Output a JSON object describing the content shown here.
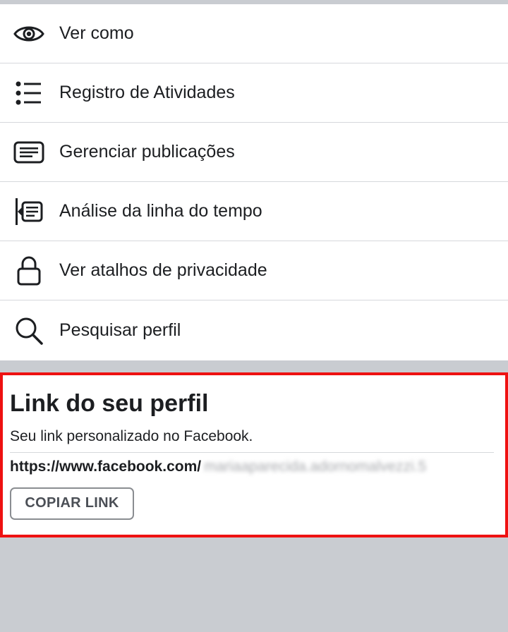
{
  "menu": {
    "items": [
      {
        "label": "Ver como",
        "icon": "eye-icon"
      },
      {
        "label": "Registro de Atividades",
        "icon": "list-icon"
      },
      {
        "label": "Gerenciar publicações",
        "icon": "posts-icon"
      },
      {
        "label": "Análise da linha do tempo",
        "icon": "timeline-review-icon"
      },
      {
        "label": "Ver atalhos de privacidade",
        "icon": "lock-icon"
      },
      {
        "label": "Pesquisar perfil",
        "icon": "search-icon"
      }
    ]
  },
  "profile_link": {
    "title": "Link do seu perfil",
    "subtitle": "Seu link personalizado no Facebook.",
    "url_prefix": "https://www.facebook.com/",
    "url_user": "mariaaparecida.adornomalvezzi.5",
    "copy_button": "COPIAR LINK"
  },
  "colors": {
    "highlight_border": "#ee1111",
    "background": "#c9ccd1"
  }
}
